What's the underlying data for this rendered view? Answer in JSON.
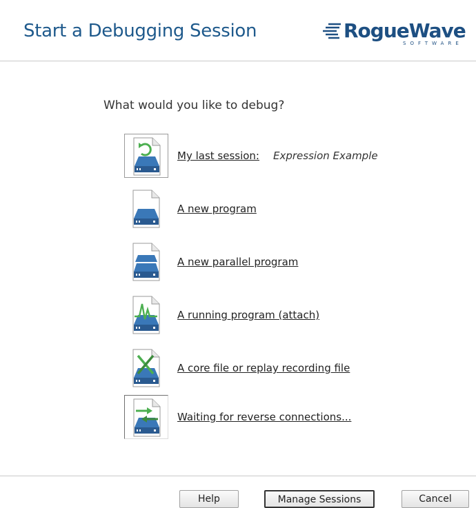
{
  "header": {
    "title": "Start a Debugging Session",
    "logo_brand": "RogueWave",
    "logo_sub": "SOFTWARE",
    "accent": "#1f5a8c"
  },
  "question": "What would you like to debug?",
  "options": [
    {
      "label": "My last session:",
      "detail": "Expression Example",
      "icon": "last-session-icon"
    },
    {
      "label": "A new program",
      "icon": "new-program-icon"
    },
    {
      "label": "A new parallel program",
      "icon": "parallel-program-icon"
    },
    {
      "label": "A running program (attach)",
      "icon": "attach-program-icon"
    },
    {
      "label": "A core file or replay recording file",
      "icon": "core-file-icon"
    },
    {
      "label": "Waiting for reverse connections...",
      "icon": "reverse-connection-icon"
    }
  ],
  "buttons": {
    "help": "Help",
    "manage": "Manage Sessions",
    "cancel": "Cancel"
  }
}
